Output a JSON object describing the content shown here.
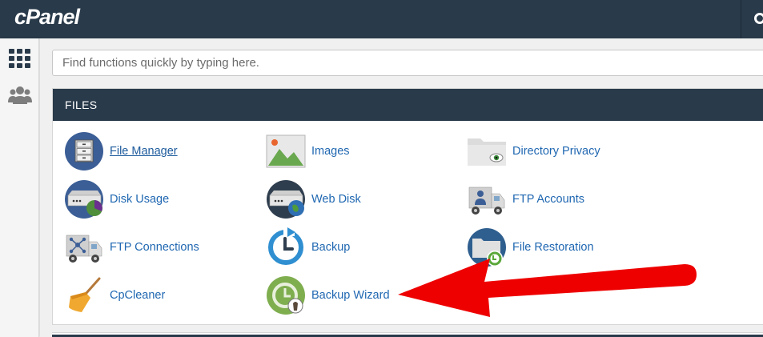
{
  "app": {
    "logo_text": "cPanel"
  },
  "search": {
    "placeholder": "Find functions quickly by typing here."
  },
  "panel": {
    "title": "FILES",
    "items": [
      {
        "label": "File Manager",
        "icon": "file-manager-icon"
      },
      {
        "label": "Images",
        "icon": "images-icon"
      },
      {
        "label": "Directory Privacy",
        "icon": "directory-privacy-icon"
      },
      {
        "label": "Disk Usage",
        "icon": "disk-usage-icon"
      },
      {
        "label": "Web Disk",
        "icon": "web-disk-icon"
      },
      {
        "label": "FTP Accounts",
        "icon": "ftp-accounts-icon"
      },
      {
        "label": "FTP Connections",
        "icon": "ftp-connections-icon"
      },
      {
        "label": "Backup",
        "icon": "backup-icon"
      },
      {
        "label": "File Restoration",
        "icon": "file-restoration-icon"
      },
      {
        "label": "CpCleaner",
        "icon": "broom-icon"
      },
      {
        "label": "Backup Wizard",
        "icon": "backup-wizard-icon"
      }
    ]
  },
  "colors": {
    "header_bg": "#293a4a",
    "link": "#1f67b1",
    "annotation_arrow": "#ee0000"
  },
  "annotation": {
    "type": "red-arrow",
    "points_to": "Backup Wizard"
  }
}
